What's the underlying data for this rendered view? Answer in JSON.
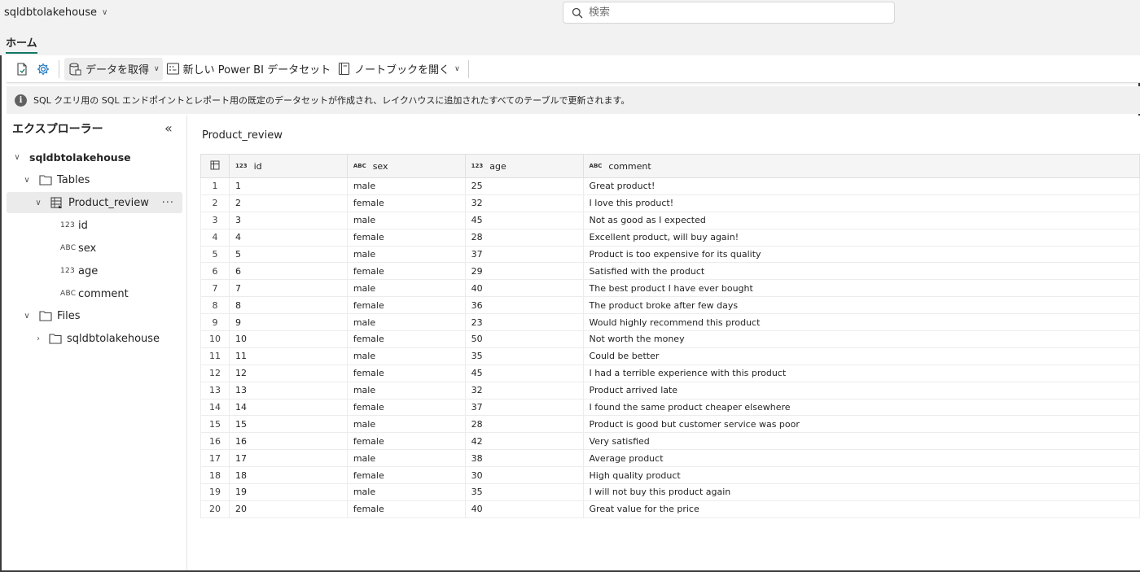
{
  "workspace": {
    "name": "sqldbtolakehouse"
  },
  "search": {
    "placeholder": "検索"
  },
  "tabs": {
    "home": "ホーム"
  },
  "toolbar": {
    "get_data": "データを取得",
    "new_dataset": "新しい Power BI データセット",
    "open_notebook": "ノートブックを開く"
  },
  "banner": {
    "text": "SQL クエリ用の SQL エンドポイントとレポート用の既定のデータセットが作成され、レイクハウスに追加されたすべてのテーブルで更新されます。"
  },
  "explorer": {
    "title": "エクスプローラー",
    "root": "sqldbtolakehouse",
    "tables_label": "Tables",
    "table_name": "Product_review",
    "more": "···",
    "columns": [
      {
        "type": "123",
        "name": "id"
      },
      {
        "type": "ABC",
        "name": "sex"
      },
      {
        "type": "123",
        "name": "age"
      },
      {
        "type": "ABC",
        "name": "comment"
      }
    ],
    "files_label": "Files",
    "files_child": "sqldbtolakehouse"
  },
  "main": {
    "table_title": "Product_review",
    "headers": [
      {
        "type": "123",
        "name": "id"
      },
      {
        "type": "ABC",
        "name": "sex"
      },
      {
        "type": "123",
        "name": "age"
      },
      {
        "type": "ABC",
        "name": "comment"
      }
    ],
    "rows": [
      [
        "1",
        "1",
        "male",
        "25",
        "Great product!"
      ],
      [
        "2",
        "2",
        "female",
        "32",
        "I love this product!"
      ],
      [
        "3",
        "3",
        "male",
        "45",
        "Not as good as I expected"
      ],
      [
        "4",
        "4",
        "female",
        "28",
        "Excellent product, will buy again!"
      ],
      [
        "5",
        "5",
        "male",
        "37",
        "Product is too expensive for its quality"
      ],
      [
        "6",
        "6",
        "female",
        "29",
        "Satisfied with the product"
      ],
      [
        "7",
        "7",
        "male",
        "40",
        "The best product I have ever bought"
      ],
      [
        "8",
        "8",
        "female",
        "36",
        "The product broke after few days"
      ],
      [
        "9",
        "9",
        "male",
        "23",
        "Would highly recommend this product"
      ],
      [
        "10",
        "10",
        "female",
        "50",
        "Not worth the money"
      ],
      [
        "11",
        "11",
        "male",
        "35",
        "Could be better"
      ],
      [
        "12",
        "12",
        "female",
        "45",
        "I had a terrible experience with this product"
      ],
      [
        "13",
        "13",
        "male",
        "32",
        "Product arrived late"
      ],
      [
        "14",
        "14",
        "female",
        "37",
        "I found the same product cheaper elsewhere"
      ],
      [
        "15",
        "15",
        "male",
        "28",
        "Product is good but customer service was poor"
      ],
      [
        "16",
        "16",
        "female",
        "42",
        "Very satisfied"
      ],
      [
        "17",
        "17",
        "male",
        "38",
        "Average product"
      ],
      [
        "18",
        "18",
        "female",
        "30",
        "High quality product"
      ],
      [
        "19",
        "19",
        "male",
        "35",
        "I will not buy this product again"
      ],
      [
        "20",
        "20",
        "female",
        "40",
        "Great value for the price"
      ]
    ]
  }
}
